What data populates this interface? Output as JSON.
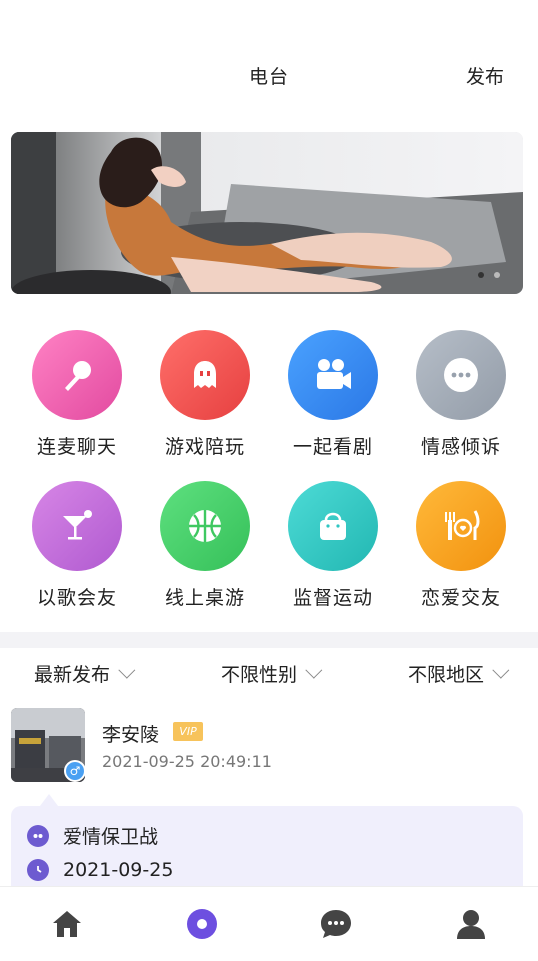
{
  "header": {
    "title": "电台",
    "publish_label": "发布"
  },
  "banner": {
    "dots": 2,
    "active_dot": 1
  },
  "categories": [
    {
      "label": "连麦聊天",
      "icon": "microphone-icon",
      "color": "#ef5fb0"
    },
    {
      "label": "游戏陪玩",
      "icon": "ghost-icon",
      "color": "#ef5350"
    },
    {
      "label": "一起看剧",
      "icon": "video-camera-icon",
      "color": "#3f8ef0"
    },
    {
      "label": "情感倾诉",
      "icon": "chat-bubble-icon",
      "color": "#a4adb8"
    },
    {
      "label": "以歌会友",
      "icon": "cocktail-icon",
      "color": "#c06ad6"
    },
    {
      "label": "线上桌游",
      "icon": "basketball-icon",
      "color": "#41cc66"
    },
    {
      "label": "监督运动",
      "icon": "bag-icon",
      "color": "#2fc6c2"
    },
    {
      "label": "恋爱交友",
      "icon": "dining-icon",
      "color": "#f6a21e"
    }
  ],
  "filters": {
    "sort": "最新发布",
    "gender": "不限性别",
    "region": "不限地区"
  },
  "post": {
    "username": "李安陵",
    "vip": "VIP",
    "timestamp": "2021-09-25 20:49:11",
    "topic": "爱情保卫战",
    "date": "2021-09-25",
    "gender_symbol": "♂"
  },
  "tabbar": {
    "items": [
      {
        "icon": "home-icon",
        "color": "#444"
      },
      {
        "icon": "radio-icon",
        "color": "#6d4fe0"
      },
      {
        "icon": "message-icon",
        "color": "#444"
      },
      {
        "icon": "profile-icon",
        "color": "#444"
      }
    ]
  }
}
